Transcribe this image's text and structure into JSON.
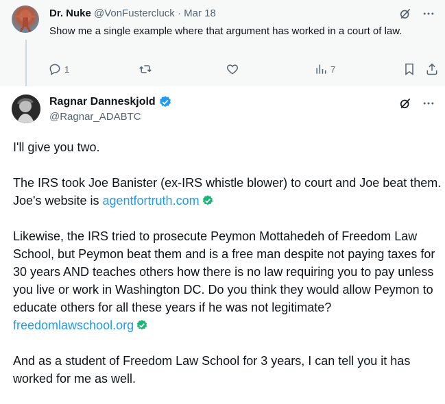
{
  "reply": {
    "name": "Dr. Nuke",
    "handle": "@VonFustercluck",
    "separator": "·",
    "date": "Mar 18",
    "text": "Show me a single example where that argument has worked in a court of law.",
    "actions": {
      "replies": "1",
      "views": "7"
    }
  },
  "tweet": {
    "name": "Ragnar Danneskjold",
    "handle": "@Ragnar_ADABTC",
    "p1": "I'll give you two.",
    "p2_text": "The IRS took Joe Banister (ex-IRS whistle blower) to court and Joe beat them. Joe's website is ",
    "p2_link": "agentfortruth.com",
    "p3_text": "Likewise, the IRS tried to prosecute Peymon Mottahedeh of Freedom Law School, but Peymon beat them and is a free man despite not paying taxes for 30 years AND teaches others how there is no law requiring you to pay unless you live or work in Washington DC. Do you think they would allow Peymon to educate others for all these years if he was not legitimate?",
    "p3_link": "freedomlawschool.org",
    "p4": "And as a student of Freedom Law School for 3 years, I can tell you it has worked for me as well."
  },
  "colors": {
    "link": "#1d9bf0",
    "verified_blue": "#1d9bf0",
    "link_check_green": "#1fb37a",
    "muted": "#536471"
  },
  "icons": [
    "grok-icon",
    "more-icon",
    "reply-icon",
    "retweet-icon",
    "like-icon",
    "views-icon",
    "bookmark-icon",
    "share-icon",
    "verified-badge-icon",
    "link-check-icon"
  ]
}
